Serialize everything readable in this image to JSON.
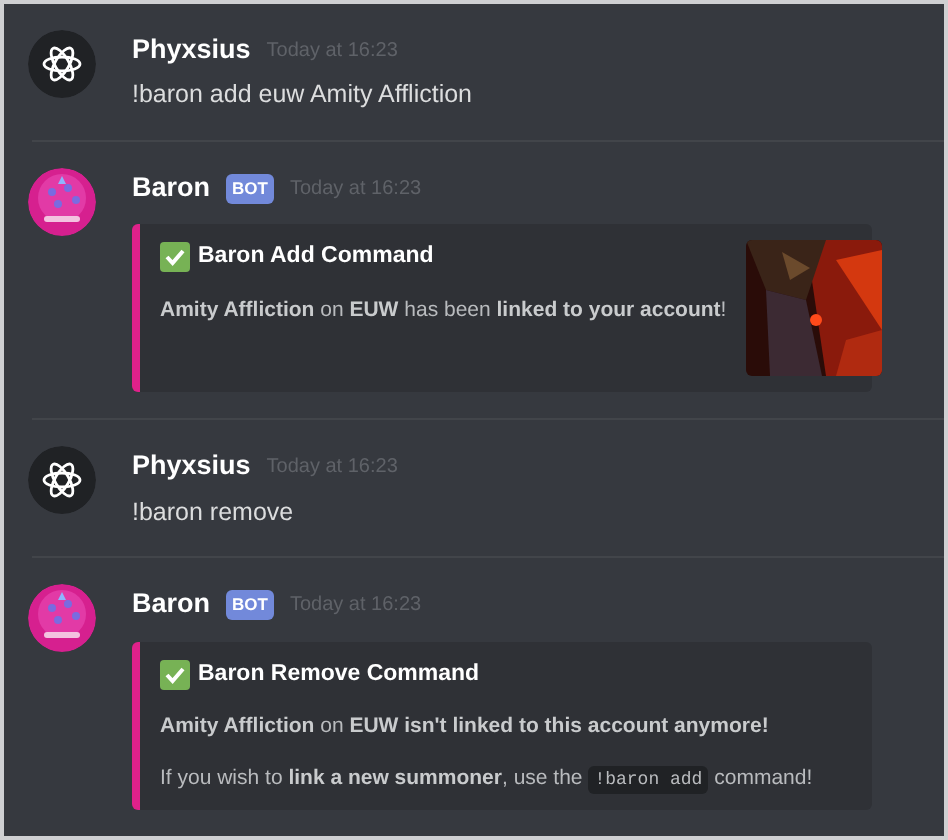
{
  "messages": [
    {
      "avatar": {
        "kind": "atom"
      },
      "author": "Phyxsius",
      "time": "Today at 16:23",
      "content": "!baron add euw Amity Affliction"
    },
    {
      "avatar": {
        "kind": "pink"
      },
      "author": "Baron",
      "bot_tag": "BOT",
      "time": "Today at 16:23",
      "embed": {
        "color": "#e0218a",
        "title": "Baron Add Command",
        "thumbnail": {
          "kind": "picture"
        },
        "lines": [
          [
            {
              "kind": "text",
              "text": "**Amity Affliction** on **EUW** has been **linked to your account**!"
            }
          ]
        ]
      }
    },
    {
      "avatar": {
        "kind": "atom"
      },
      "author": "Phyxsius",
      "time": "Today at 16:23",
      "content": "!baron remove"
    },
    {
      "avatar": {
        "kind": "pink"
      },
      "author": "Baron",
      "bot_tag": "BOT",
      "time": "Today at 16:23",
      "embed": {
        "color": "#e0218a",
        "title": "Baron Remove Command",
        "lines": [
          [
            {
              "kind": "text",
              "text": "**Amity Affliction** on **EUW isn't linked to this account anymore!**"
            }
          ],
          [
            {
              "kind": "text",
              "text": "If you wish to **link a new summoner**, use the "
            },
            {
              "kind": "code",
              "text": "!baron add"
            },
            {
              "kind": "text",
              "text": " command!"
            }
          ]
        ]
      }
    }
  ]
}
